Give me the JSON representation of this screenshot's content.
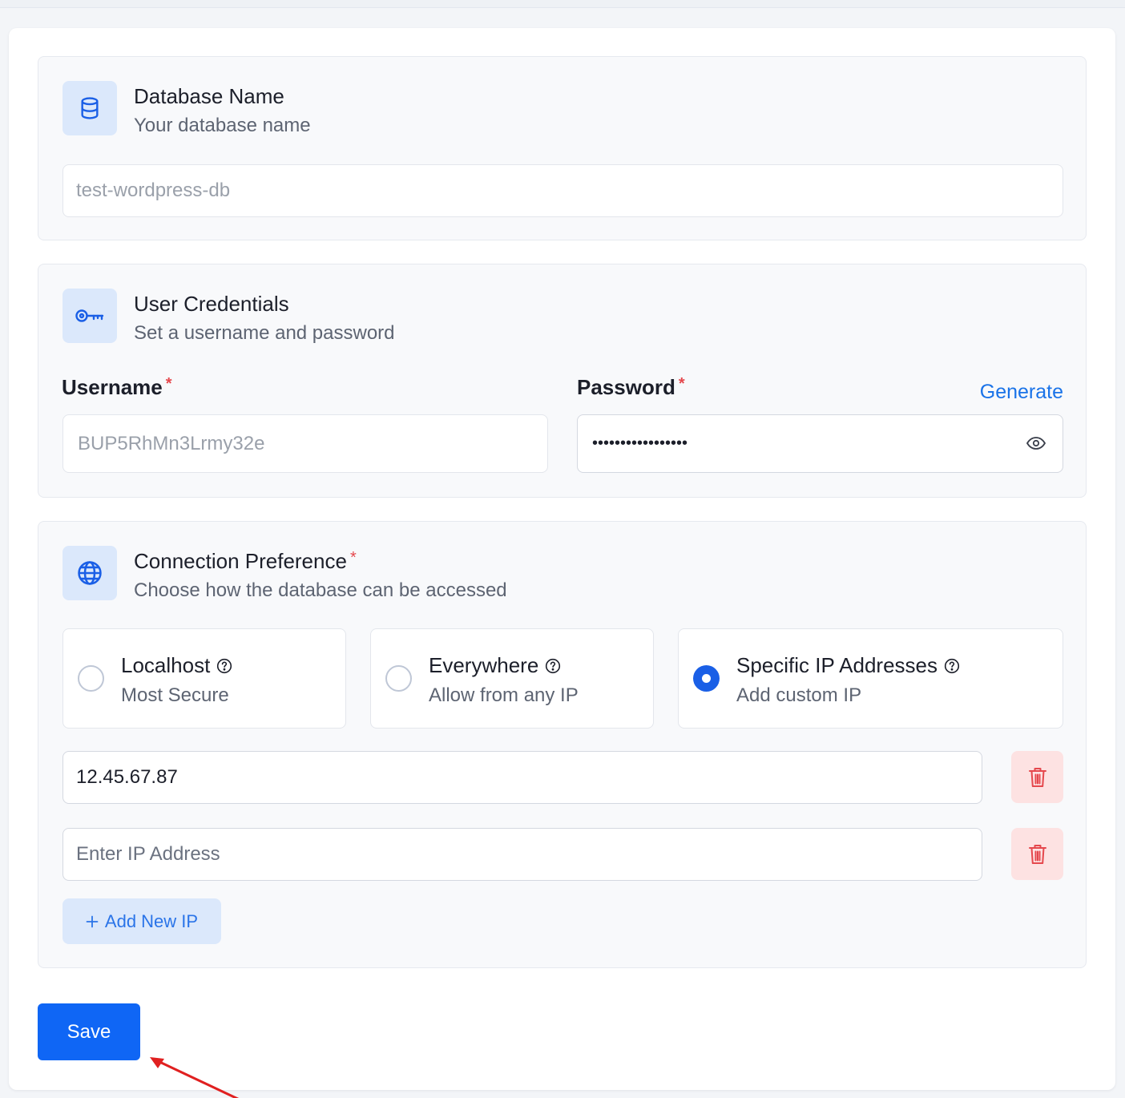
{
  "database": {
    "title": "Database Name",
    "subtitle": "Your database name",
    "value": "test-wordpress-db",
    "icon": "database-icon"
  },
  "credentials": {
    "title": "User Credentials",
    "subtitle": "Set a username and password",
    "icon": "key-icon",
    "username_label": "Username",
    "username_value": "BUP5RhMn3Lrmy32e",
    "password_label": "Password",
    "password_value": "•••••••••••••••••",
    "generate_label": "Generate",
    "required_mark": "*"
  },
  "connection": {
    "title": "Connection Preference",
    "subtitle": "Choose how the database can be accessed",
    "icon": "globe-icon",
    "required_mark": "*",
    "options": [
      {
        "title": "Localhost",
        "subtitle": "Most Secure",
        "selected": false
      },
      {
        "title": "Everywhere",
        "subtitle": "Allow from any IP",
        "selected": false
      },
      {
        "title": "Specific IP Addresses",
        "subtitle": "Add custom IP",
        "selected": true
      }
    ],
    "ip_entries": [
      {
        "value": "12.45.67.87"
      },
      {
        "value": "",
        "placeholder": "Enter IP Address"
      }
    ],
    "add_ip_label": "Add New IP"
  },
  "actions": {
    "save_label": "Save"
  },
  "colors": {
    "accent": "#0f66f5",
    "link": "#1a73e8",
    "danger": "#e5484d",
    "icon_bg": "#dbe8fb",
    "trash_bg": "#fde2e2",
    "annotation_arrow": "#e02020"
  }
}
